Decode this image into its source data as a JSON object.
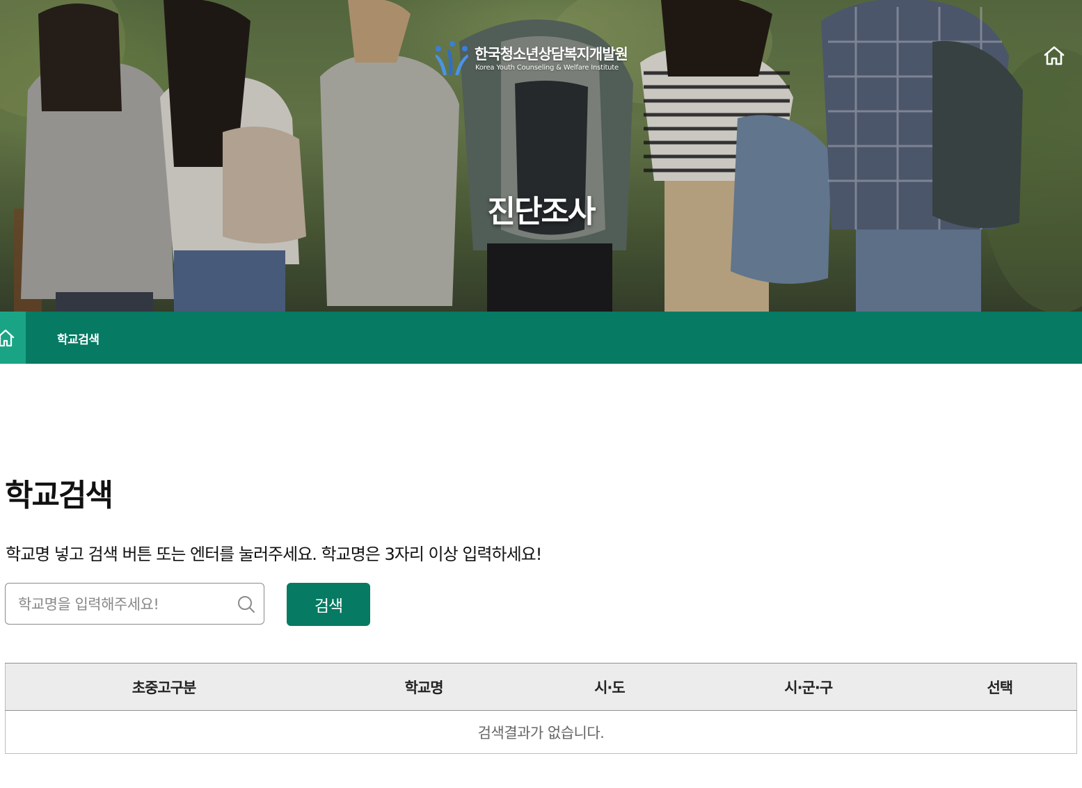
{
  "hero": {
    "logo_korean": "한국청소년상담복지개발원",
    "logo_english": "Korea Youth Counseling & Welfare Institute",
    "title": "진단조사"
  },
  "navbar": {
    "breadcrumb": "학교검색"
  },
  "main": {
    "title": "학교검색",
    "instruction": "학교명 넣고 검색 버튼 또는 엔터를 눌러주세요. 학교명은 3자리 이상 입력하세요!",
    "search": {
      "placeholder": "학교명을 입력해주세요!",
      "value": "",
      "button_label": "검색"
    },
    "table": {
      "columns": [
        "초중고구분",
        "학교명",
        "시·도",
        "시·군·구",
        "선택"
      ],
      "empty_message": "검색결과가 없습니다."
    }
  },
  "colors": {
    "accent": "#067a63",
    "accent_light": "#19a585",
    "table_header_bg": "#ececec"
  },
  "icons": [
    "logo-mark-icon",
    "home-icon",
    "search-icon"
  ]
}
